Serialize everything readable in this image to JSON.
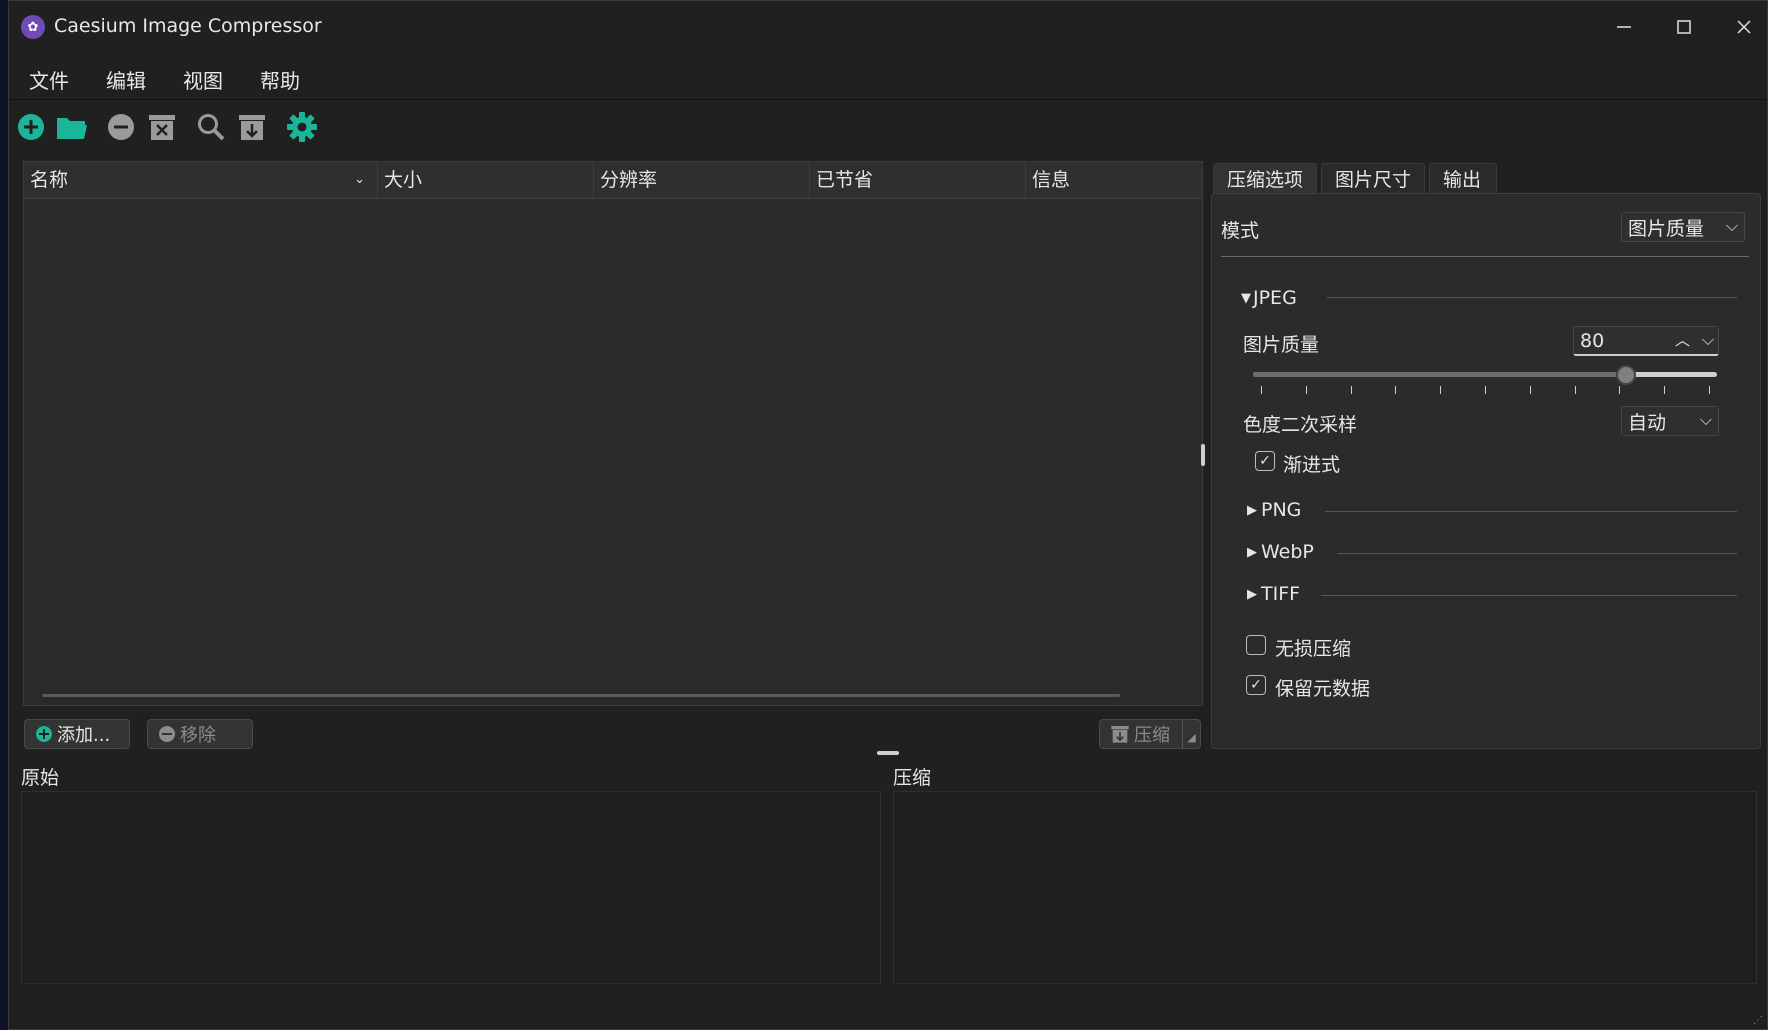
{
  "window": {
    "title": "Caesium Image Compressor",
    "minimize": "—",
    "maximize": "☐",
    "close": "✕"
  },
  "menu": [
    "文件",
    "编辑",
    "视图",
    "帮助"
  ],
  "toolbar": {
    "icons": [
      "add-icon",
      "open-folder-icon",
      "remove-icon",
      "clear-list-icon",
      "preview-search-icon",
      "compress-archive-icon",
      "settings-gear-icon"
    ],
    "accent": "#1bb59a",
    "muted": "#9a9a9a"
  },
  "table": {
    "columns": [
      "名称",
      "大小",
      "分辨率",
      "已节省",
      "信息"
    ]
  },
  "buttons": {
    "add": "添加...",
    "remove": "移除",
    "compress": "压缩"
  },
  "preview": {
    "original": "原始",
    "compressed": "压缩"
  },
  "tabs": [
    "压缩选项",
    "图片尺寸",
    "输出"
  ],
  "compression": {
    "mode_label": "模式",
    "mode_value": "图片质量",
    "jpeg": {
      "header": "JPEG",
      "quality_label": "图片质量",
      "quality_value": "80",
      "slider_fraction": 0.8,
      "chroma_label": "色度二次采样",
      "chroma_value": "自动",
      "progressive_label": "渐进式",
      "progressive_checked": true
    },
    "groups": [
      "PNG",
      "WebP",
      "TIFF"
    ],
    "lossless_label": "无损压缩",
    "lossless_checked": false,
    "keep_metadata_label": "保留元数据",
    "keep_metadata_checked": true
  }
}
